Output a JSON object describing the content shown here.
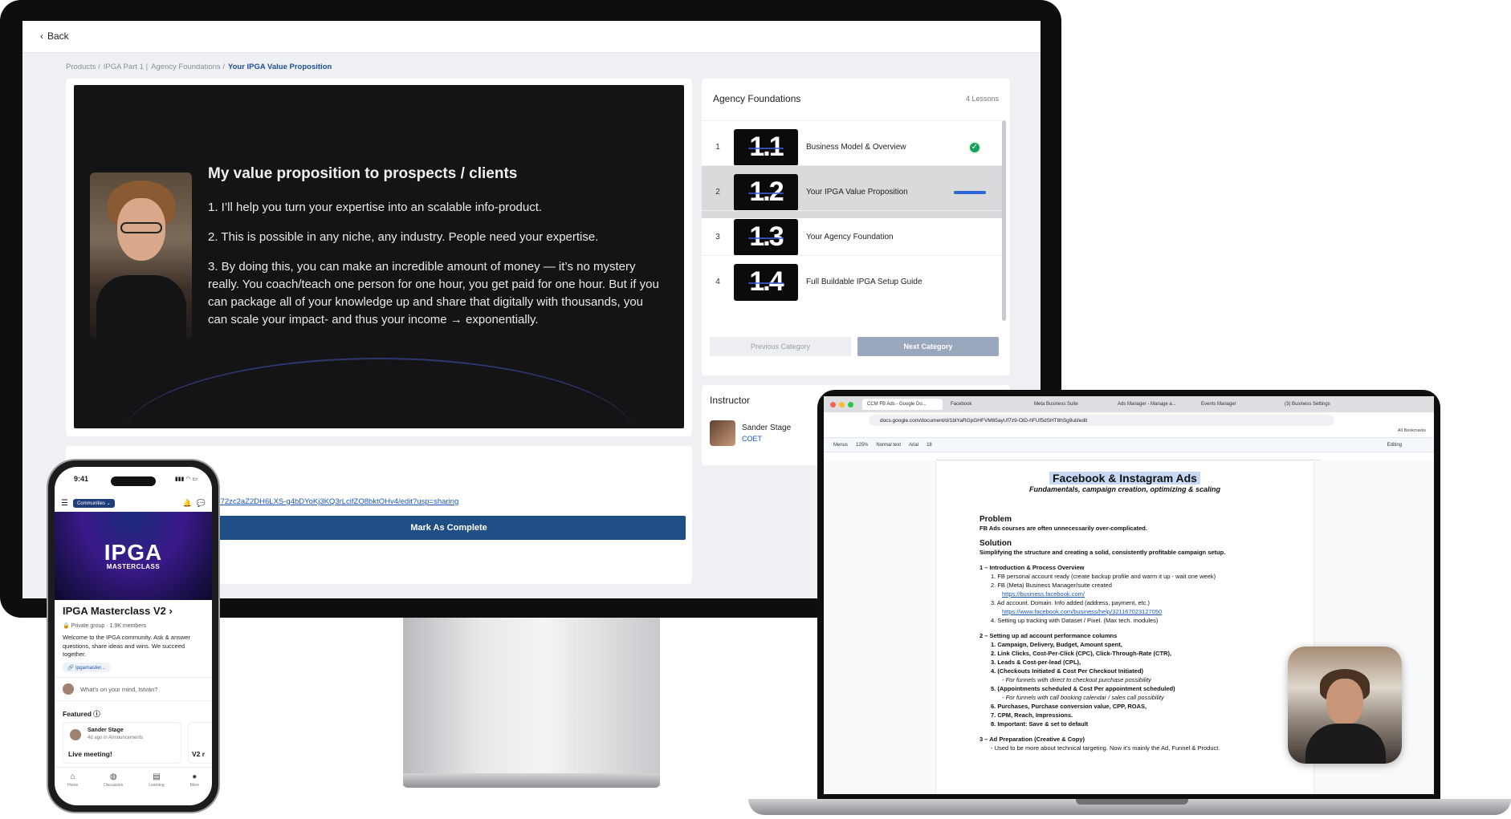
{
  "imac": {
    "back_label": "Back",
    "breadcrumb": [
      "Products /",
      "IPGA Part 1 |",
      "Agency Foundations /"
    ],
    "breadcrumb_current": "Your IPGA Value Proposition",
    "video": {
      "title": "My value proposition to prospects / clients",
      "points": [
        "1. I’ll help you turn your expertise into an scalable info-product.",
        "2. This is possible in any niche, any industry. People need your expertise.",
        "3. By doing this, you can make an incredible amount of money — it’s no mystery really. You coach/teach one person for one hour, you get paid for one hour. But if you can package all of your knowledge up and share that digitally with thousands, you can scale your impact- and thus your income → exponentially."
      ]
    },
    "resource_link": "1L72zc2aZ2DH6LXS-g4bDYoKj3KQ3rLcifZO8bktOHv4/edit?usp=sharing",
    "mark_complete": "Mark As Complete",
    "course_panel": {
      "title": "Agency Foundations",
      "count": "4 Lessons",
      "lessons": [
        {
          "num": "1",
          "thumb": "1.1",
          "title": "Business Model & Overview",
          "status": "complete"
        },
        {
          "num": "2",
          "thumb": "1.2",
          "title": "Your IPGA Value Proposition",
          "status": "in-progress"
        },
        {
          "num": "3",
          "thumb": "1.3",
          "title": "Your Agency Foundation",
          "status": ""
        },
        {
          "num": "4",
          "thumb": "1.4",
          "title": "Full Buildable IPGA Setup Guide",
          "status": ""
        }
      ],
      "prev": "Previous Category",
      "next": "Next Category"
    },
    "instructor": {
      "title": "Instructor",
      "name": "Sander Stage",
      "role": "COET"
    }
  },
  "laptop": {
    "tabs": [
      "CCM FB Ads - Google Do...",
      "Facebook",
      "Meta Business Suite",
      "Ads Manager - Manage a...",
      "Events Manager",
      "(3) Business Settings"
    ],
    "url": "docs.google.com/document/d/1blYaRGpGHFVM65ayUf7z9-OlD-hFUf5dSHT8hSg9uil/edit",
    "bookmarks": "All Bookmarks",
    "toolbar": [
      "Menus",
      "125%",
      "Normal text",
      "Arial",
      "18",
      "Editing"
    ],
    "doc": {
      "title": "Facebook & Instagram Ads",
      "subtitle": "Fundamentals, campaign creation, optimizing & scaling",
      "problem_h": "Problem",
      "problem": "FB Ads courses are often unnecessarily over-complicated.",
      "solution_h": "Solution",
      "solution": "Simplifying the structure and creating a solid, consistently profitable campaign setup.",
      "s1": "1 – Introduction & Process Overview",
      "s1_items": [
        "1.   FB personal account ready (create backup profile and warm it up - wait one week)",
        "2.   FB (Meta) Business Manager/suite created"
      ],
      "s1_link1": "https://business.facebook.com/",
      "s1_item3": "3.   Ad account. Domain. Info added (address, payment, etc.)",
      "s1_link2": "https://www.facebook.com/business/help/321167023127050",
      "s1_item4": "4.   Setting up tracking with Dataset / Pixel. (Max tech. modules)",
      "s2": "2 – Setting up ad account performance columns",
      "s2_items": [
        "1.   Campaign, Delivery, Budget, Amount spent,",
        "2.   Link Clicks, Cost-Per-Click (CPC), Click-Through-Rate (CTR),",
        "3.   Leads & Cost-per-lead (CPL),",
        "4.   (Checkouts Initiated & Cost Per Checkout Initiated)"
      ],
      "s2_sub1": "- For funnels with direct to checkout purchase possibility",
      "s2_item5": "5.   (Appointments scheduled & Cost Per appointment scheduled)",
      "s2_sub2": "- For funnels with call booking calendar / sales call possibility",
      "s2_items2": [
        "6.   Purchases, Purchase conversion value, CPP, ROAS,",
        "7.   CPM, Reach, Impressions.",
        "8.   Important: Save & set to default"
      ],
      "s3": "3 – Ad Preparation (Creative & Copy)",
      "s3_item": "-    Used to be more about technical targeting. Now it’s mainly the Ad, Funnel & Product."
    }
  },
  "phone": {
    "time": "9:41",
    "status": "▮▮▮ ◠ ▭",
    "communities": "Communities ⌄",
    "banner_title": "IPGA",
    "banner_sub": "MASTERCLASS",
    "group_title": "IPGA Masterclass V2 ›",
    "group_meta": "🔒 Private group · 1.9K members",
    "group_desc": "Welcome to the IPGA community. Ask & answer questions, share ideas and wins. We succeed together.",
    "group_link": "🔗 ipgamaster...",
    "post_prompt": "What's on your mind, István?",
    "featured": "Featured ⓘ",
    "card_name": "Sander Stage",
    "card_meta": "4d ago in Announcements",
    "card_title": "Live meeting!",
    "card2_title": "V2 r",
    "nav": [
      "Home",
      "Discussion",
      "Learning",
      "More"
    ]
  }
}
